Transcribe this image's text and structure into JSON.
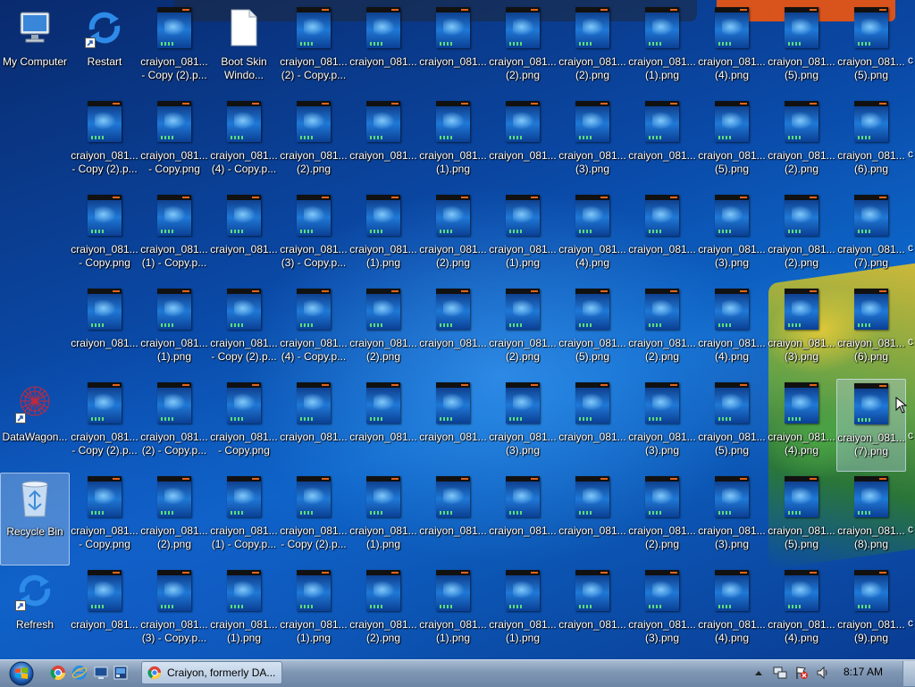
{
  "desktop": {
    "system_icons": [
      {
        "name": "my-computer-icon",
        "label": "My Computer",
        "kind": "computer"
      },
      {
        "name": "restart-icon",
        "label": "Restart",
        "kind": "refresh-shortcut"
      },
      {
        "name": "datawagon-icon",
        "label": "DataWagon...",
        "kind": "datawagon-shortcut"
      },
      {
        "name": "recycle-bin-icon",
        "label": "Recycle Bin",
        "kind": "recycle-bin"
      },
      {
        "name": "refresh-icon",
        "label": "Refresh",
        "kind": "refresh-shortcut"
      }
    ],
    "boot_skin": {
      "label": "Boot Skin\nWindo..."
    },
    "file_rows": [
      [
        "craiyon_081...\n- Copy (2).p...",
        "",
        "craiyon_081...\n(2) - Copy.p...",
        "craiyon_081...",
        "craiyon_081...",
        "craiyon_081...\n(2).png",
        "craiyon_081...\n(2).png",
        "craiyon_081...\n(1).png",
        "craiyon_081...\n(4).png",
        "craiyon_081...\n(5).png",
        "craiyon_081...\n(5).png"
      ],
      [
        "craiyon_081...\n- Copy (2).p...",
        "craiyon_081...\n- Copy.png",
        "craiyon_081...\n(4) - Copy.p...",
        "craiyon_081...\n(2).png",
        "craiyon_081...",
        "craiyon_081...\n(1).png",
        "craiyon_081...",
        "craiyon_081...\n(3).png",
        "craiyon_081...",
        "craiyon_081...\n(5).png",
        "craiyon_081...\n(2).png",
        "craiyon_081...\n(6).png"
      ],
      [
        "craiyon_081...\n- Copy.png",
        "craiyon_081...\n(1) - Copy.p...",
        "craiyon_081...",
        "craiyon_081...\n(3) - Copy.p...",
        "craiyon_081...\n(1).png",
        "craiyon_081...\n(2).png",
        "craiyon_081...\n(1).png",
        "craiyon_081...\n(4).png",
        "craiyon_081...",
        "craiyon_081...\n(3).png",
        "craiyon_081...\n(2).png",
        "craiyon_081...\n(7).png"
      ],
      [
        "craiyon_081...",
        "craiyon_081...\n(1).png",
        "craiyon_081...\n- Copy (2).p...",
        "craiyon_081...\n(4) - Copy.p...",
        "craiyon_081...\n(2).png",
        "craiyon_081...",
        "craiyon_081...\n(2).png",
        "craiyon_081...\n(5).png",
        "craiyon_081...\n(2).png",
        "craiyon_081...\n(4).png",
        "craiyon_081...\n(3).png",
        "craiyon_081...\n(6).png"
      ],
      [
        "craiyon_081...\n- Copy (2).p...",
        "craiyon_081...\n(2) - Copy.p...",
        "craiyon_081...\n- Copy.png",
        "craiyon_081...",
        "craiyon_081...",
        "craiyon_081...",
        "craiyon_081...\n(3).png",
        "craiyon_081...",
        "craiyon_081...\n(3).png",
        "craiyon_081...\n(5).png",
        "craiyon_081...\n(4).png",
        "craiyon_081...\n(7).png"
      ],
      [
        "craiyon_081...\n- Copy.png",
        "craiyon_081...\n(2).png",
        "craiyon_081...\n(1) - Copy.p...",
        "craiyon_081...\n- Copy (2).p...",
        "craiyon_081...\n(1).png",
        "craiyon_081...",
        "craiyon_081...",
        "craiyon_081...",
        "craiyon_081...\n(2).png",
        "craiyon_081...\n(3).png",
        "craiyon_081...\n(5).png",
        "craiyon_081...\n(8).png"
      ],
      [
        "craiyon_081...",
        "craiyon_081...\n(3) - Copy.p...",
        "craiyon_081...\n(1).png",
        "craiyon_081...\n(1).png",
        "craiyon_081...\n(2).png",
        "craiyon_081...\n(1).png",
        "craiyon_081...\n(1).png",
        "craiyon_081...",
        "craiyon_081...\n(3).png",
        "craiyon_081...\n(4).png",
        "craiyon_081...\n(4).png",
        "craiyon_081...\n(9).png"
      ]
    ],
    "edge_char": "c"
  },
  "taskbar": {
    "start_label": "Start",
    "active_task_label": "Craiyon, formerly DA...",
    "clock": "8:17 AM",
    "tray_icons": [
      "show-hidden-icons-arrow-icon",
      "network-icon",
      "action-center-flag-icon",
      "volume-icon"
    ]
  },
  "colors": {
    "desktop_blue": "#0a4aa8",
    "taskbar": "#7f96b3",
    "accent_orange": "#d9531c"
  }
}
